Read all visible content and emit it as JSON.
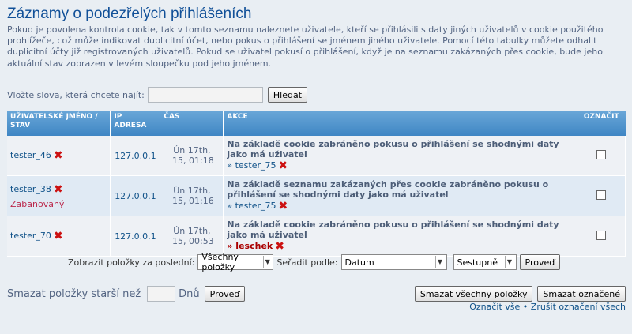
{
  "title": "Záznamy o podezřelých přihlášeních",
  "intro": "Pokud je povolena kontrola cookie, tak v tomto seznamu naleznete uživatele, kteří se přihlásili s daty jiných uživatelů v cookie použitého prohlížeče, což může indikovat duplicitní účet, nebo pokus o přihlášení se jménem jiného uživatele. Pomocí této tabulky můžete odhalit duplicitní účty již registrovaných uživatelů. Pokud se uživatel pokusí o přihlášení, když je na seznamu zakázaných přes cookie, bude jeho aktuální stav zobrazen v levém sloupečku pod jeho jménem.",
  "search": {
    "label": "Vložte slova, která chcete najít:",
    "value": "",
    "button": "Hledat"
  },
  "table": {
    "headers": [
      "UŽIVATELSKÉ JMÉNO / STAV",
      "IP ADRESA",
      "ČAS",
      "AKCE",
      "OZNAČIT"
    ],
    "rows": [
      {
        "user": "tester_46",
        "status": "",
        "ip": "127.0.0.1",
        "time": "Ún 17th, '15, 01:18",
        "action": "Na základě cookie zabráněno pokusu o přihlášení se shodnými daty jako má uživatel",
        "target": "» tester_75"
      },
      {
        "user": "tester_38",
        "status": "Zabanovaný",
        "ip": "127.0.0.1",
        "time": "Ún 17th, '15, 01:16",
        "action": "Na základě seznamu zakázaných přes cookie zabráněno pokusu o přihlášení se shodnými daty jako má uživatel",
        "target": "» tester_75"
      },
      {
        "user": "tester_70",
        "status": "",
        "ip": "127.0.0.1",
        "time": "Ún 17th, '15, 00:53",
        "action": "Na základě cookie zabráněno pokusu o přihlášení se shodnými daty jako má uživatel",
        "target": "» leschek"
      }
    ]
  },
  "filters": {
    "show_label": "Zobrazit položky za poslední:",
    "show_value": "Všechny položky",
    "sort_label": "Seřadit podle:",
    "sort_value": "Datum",
    "order_value": "Sestupně",
    "button": "Proveď"
  },
  "purge": {
    "label": "Smazat položky starší než",
    "days_label": "Dnů",
    "button": "Proveď"
  },
  "actions": {
    "delete_all": "Smazat všechny položky",
    "delete_marked": "Smazat označené"
  },
  "links": {
    "mark_all": "Označit vše",
    "separator": "•",
    "unmark_all": "Zrušit označení všech"
  },
  "colors": {
    "title": "#115098",
    "header_bg": "#3f86c4",
    "banned": "#bc2a4d",
    "delete_icon": "#cc1111"
  }
}
